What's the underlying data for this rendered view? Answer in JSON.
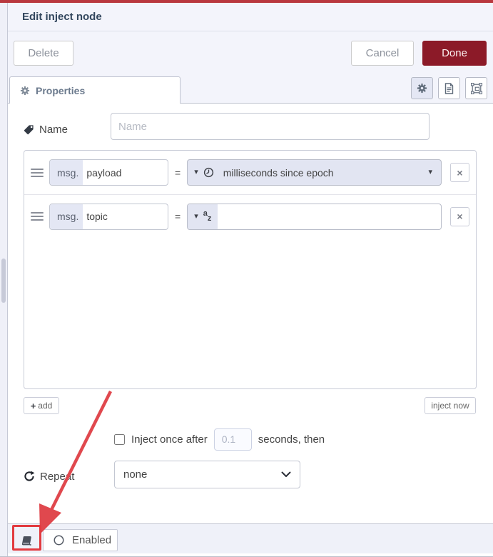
{
  "window": {
    "title": "Edit inject node"
  },
  "buttons": {
    "delete": "Delete",
    "cancel": "Cancel",
    "done": "Done"
  },
  "tabbar": {
    "properties": "Properties"
  },
  "icons": {
    "caret_down": "▾",
    "close": "×",
    "plus": "+",
    "az_a": "a",
    "az_z": "z"
  },
  "name_row": {
    "label": "Name",
    "placeholder": "Name"
  },
  "props": {
    "rows": [
      {
        "prefix": "msg.",
        "property": "payload",
        "equals": "=",
        "value_label": "milliseconds since epoch"
      },
      {
        "prefix": "msg.",
        "property": "topic",
        "equals": "=",
        "value_label": ""
      }
    ],
    "add": "add",
    "inject_now": "inject now"
  },
  "once": {
    "label": "Inject once after",
    "value": "0.1",
    "suffix": "seconds, then"
  },
  "repeat": {
    "label": "Repeat",
    "value": "none"
  },
  "footer": {
    "enabled": "Enabled"
  },
  "colors": {
    "accent": "#8C1A28",
    "panel": "#f3f4fb",
    "highlight": "#e2e5f2",
    "annotation": "#e0484e",
    "top_line": "#b9383e"
  }
}
